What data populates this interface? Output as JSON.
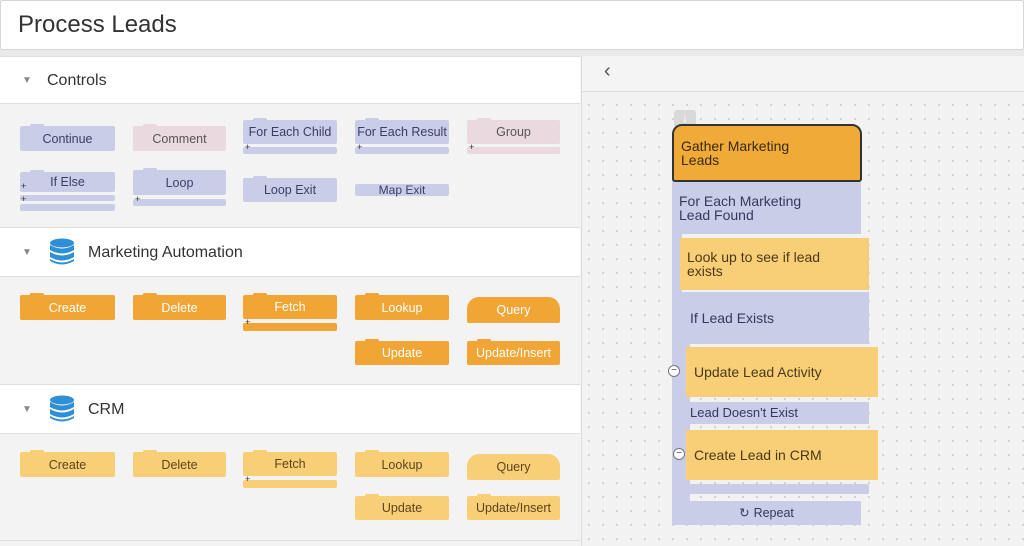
{
  "page": {
    "title": "Process Leads"
  },
  "sections": {
    "controls": {
      "title": "Controls",
      "blocks": {
        "continue": "Continue",
        "comment": "Comment",
        "for_each_child": "For Each Child",
        "for_each_result": "For Each Result",
        "group": "Group",
        "if_else": "If Else",
        "loop": "Loop",
        "loop_exit": "Loop Exit",
        "map_exit": "Map Exit"
      }
    },
    "marketing": {
      "title": "Marketing Automation",
      "blocks": {
        "create": "Create",
        "delete": "Delete",
        "fetch": "Fetch",
        "lookup": "Lookup",
        "query": "Query",
        "update": "Update",
        "upsert": "Update/Insert"
      }
    },
    "crm": {
      "title": "CRM",
      "blocks": {
        "create": "Create",
        "delete": "Delete",
        "fetch": "Fetch",
        "lookup": "Lookup",
        "query": "Query",
        "update": "Update",
        "upsert": "Update/Insert"
      }
    }
  },
  "canvas": {
    "flow": {
      "gather": "Gather Marketing Leads",
      "for_each": "For Each Marketing Lead Found",
      "look_up": "Look up to see if lead exists",
      "if_exists": "If Lead Exists",
      "update_activity": "Update Lead Activity",
      "doesnt_exist": "Lead Doesn't Exist",
      "create_crm": "Create Lead in CRM",
      "repeat": "Repeat"
    }
  },
  "icons": {
    "collapse": "triangle-down-icon",
    "database": "database-icon",
    "back": "chevron-left-icon",
    "download": "download-arrow-icon",
    "repeat": "repeat-icon",
    "expand": "plus-icon",
    "collapse_branch": "minus-icon"
  },
  "colors": {
    "control_block": "#c9cde7",
    "comment_block": "#ead9df",
    "marketing_block": "#f0a534",
    "crm_block": "#f8cf77",
    "database_icon": "#2f8fd6"
  }
}
